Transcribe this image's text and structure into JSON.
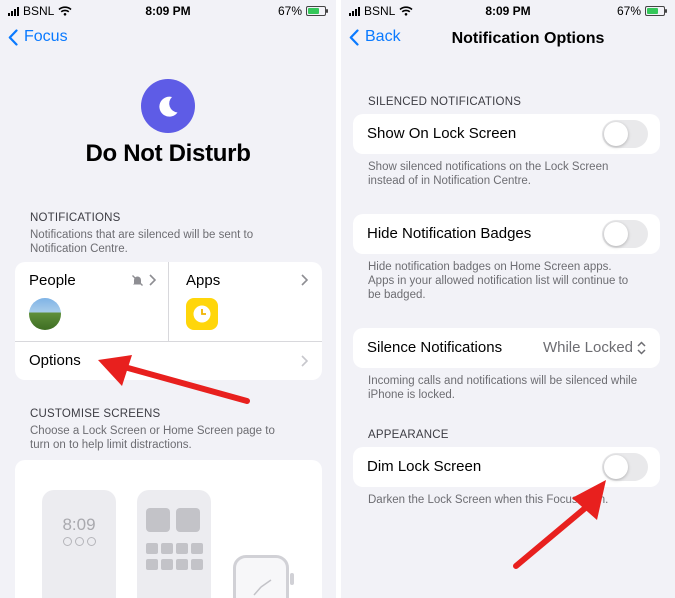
{
  "status_bar": {
    "carrier": "BSNL",
    "time": "8:09 PM",
    "battery": "67%",
    "battery_level": 0.67
  },
  "left_screen": {
    "back_label": "Focus",
    "title": "Do Not Disturb",
    "notifications": {
      "header": "NOTIFICATIONS",
      "description": "Notifications that are silenced will be sent to Notification Centre.",
      "people_label": "People",
      "apps_label": "Apps",
      "options_label": "Options"
    },
    "customise": {
      "header": "CUSTOMISE SCREENS",
      "description": "Choose a Lock Screen or Home Screen page to turn on to help limit distractions.",
      "lock_time": "8:09"
    }
  },
  "right_screen": {
    "back_label": "Back",
    "title": "Notification Options",
    "silenced": {
      "header": "SILENCED NOTIFICATIONS",
      "show_on_lock_label": "Show On Lock Screen",
      "show_on_lock_desc": "Show silenced notifications on the Lock Screen instead of in Notification Centre.",
      "hide_badges_label": "Hide Notification Badges",
      "hide_badges_desc": "Hide notification badges on Home Screen apps. Apps in your allowed notification list will continue to be badged.",
      "silence_label": "Silence Notifications",
      "silence_value": "While Locked",
      "silence_desc": "Incoming calls and notifications will be silenced while iPhone is locked."
    },
    "appearance": {
      "header": "APPEARANCE",
      "dim_label": "Dim Lock Screen",
      "dim_desc": "Darken the Lock Screen when this Focus is on."
    }
  },
  "colors": {
    "accent": "#0a7aff",
    "focus_purple": "#5e5ce6",
    "clock_yellow": "#ffd60a",
    "annotation_red": "#e8201e",
    "background": "#f2f2f7"
  }
}
